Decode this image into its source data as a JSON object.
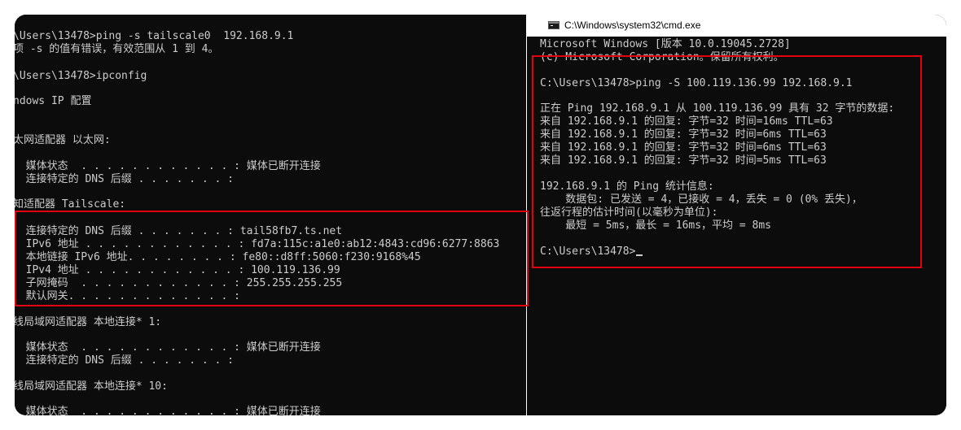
{
  "left_terminal": {
    "lines": [
      "\\Users\\13478>ping -s tailscale0  192.168.9.1",
      "项 -s 的值有错误，有效范围从 1 到 4。",
      "\\Users\\13478>ipconfig",
      "ndows IP 配置",
      "太网适配器 以太网:",
      "  媒体状态  . . . . . . . . . . . . : 媒体已断开连接",
      "  连接特定的 DNS 后缀 . . . . . . . :",
      "知适配器 Tailscale:",
      "  连接特定的 DNS 后缀 . . . . . . . : tail58fb7.ts.net",
      "  IPv6 地址 . . . . . . . . . . . . : fd7a:115c:a1e0:ab12:4843:cd96:6277:8863",
      "  本地链接 IPv6 地址. . . . . . . . : fe80::d8ff:5060:f230:9168%45",
      "  IPv4 地址 . . . . . . . . . . . . : 100.119.136.99",
      "  子网掩码  . . . . . . . . . . . . : 255.255.255.255",
      "  默认网关. . . . . . . . . . . . . :",
      "线局域网适配器 本地连接* 1:",
      "  媒体状态  . . . . . . . . . . . . : 媒体已断开连接",
      "  连接特定的 DNS 后缀 . . . . . . . :",
      "线局域网适配器 本地连接* 10:",
      "  媒体状态  . . . . . . . . . . . . : 媒体已断开连接"
    ]
  },
  "right_window": {
    "title": "C:\\Windows\\system32\\cmd.exe",
    "lines": [
      "Microsoft Windows [版本 10.0.19045.2728]",
      "(c) Microsoft Corporation。保留所有权利。",
      "C:\\Users\\13478>ping -S 100.119.136.99 192.168.9.1",
      "正在 Ping 192.168.9.1 从 100.119.136.99 具有 32 字节的数据:",
      "来自 192.168.9.1 的回复: 字节=32 时间=16ms TTL=63",
      "来自 192.168.9.1 的回复: 字节=32 时间=6ms TTL=63",
      "来自 192.168.9.1 的回复: 字节=32 时间=6ms TTL=63",
      "来自 192.168.9.1 的回复: 字节=32 时间=5ms TTL=63",
      "192.168.9.1 的 Ping 统计信息:",
      "    数据包: 已发送 = 4，已接收 = 4，丢失 = 0 (0% 丢失)，",
      "往返行程的估计时间(以毫秒为单位):",
      "    最短 = 5ms，最长 = 16ms，平均 = 8ms",
      "C:\\Users\\13478>"
    ]
  },
  "colors": {
    "terminal_bg": "#0c0c0c",
    "terminal_text": "#cccccc",
    "highlight": "#e3000f"
  },
  "icons": {
    "window_icon": "cmd-icon",
    "cursor": "text-cursor"
  }
}
